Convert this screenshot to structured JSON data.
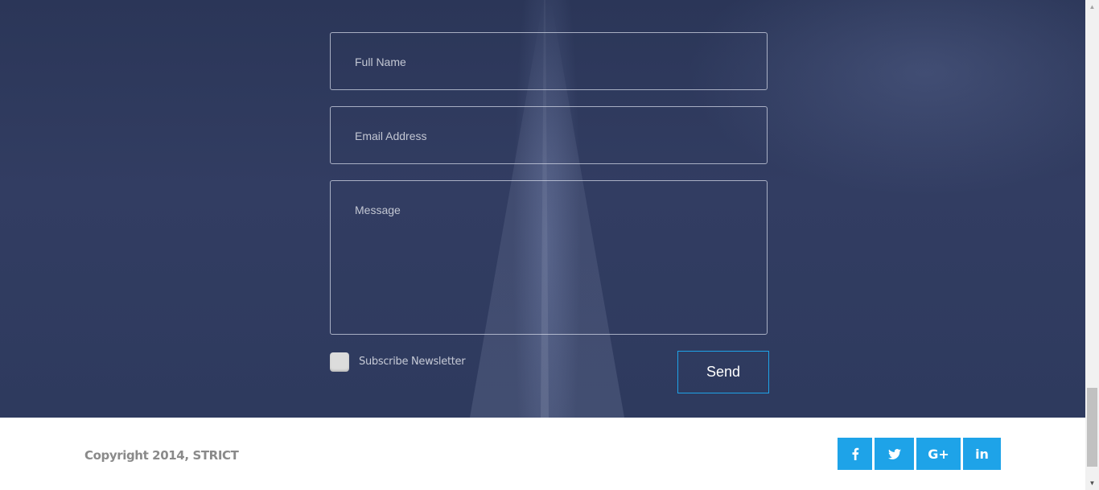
{
  "contact_form": {
    "full_name_placeholder": "Full Name",
    "email_placeholder": "Email Address",
    "message_placeholder": "Message",
    "subscribe_label": "Subscribe Newsletter",
    "subscribe_checked": false,
    "send_label": "Send"
  },
  "footer": {
    "copyright": "Copyright 2014, STRICT",
    "social": [
      {
        "name": "facebook-icon",
        "glyph": "f"
      },
      {
        "name": "twitter-icon",
        "glyph": "🐦"
      },
      {
        "name": "google-plus-icon",
        "glyph": "G+"
      },
      {
        "name": "linkedin-icon",
        "glyph": "in"
      }
    ]
  },
  "colors": {
    "accent": "#1ea3e8",
    "section_bg": "#2e3a5e",
    "footer_text": "#8a8a8a"
  },
  "scrollbar": {
    "up_arrow": "▲",
    "down_arrow": "▼"
  }
}
